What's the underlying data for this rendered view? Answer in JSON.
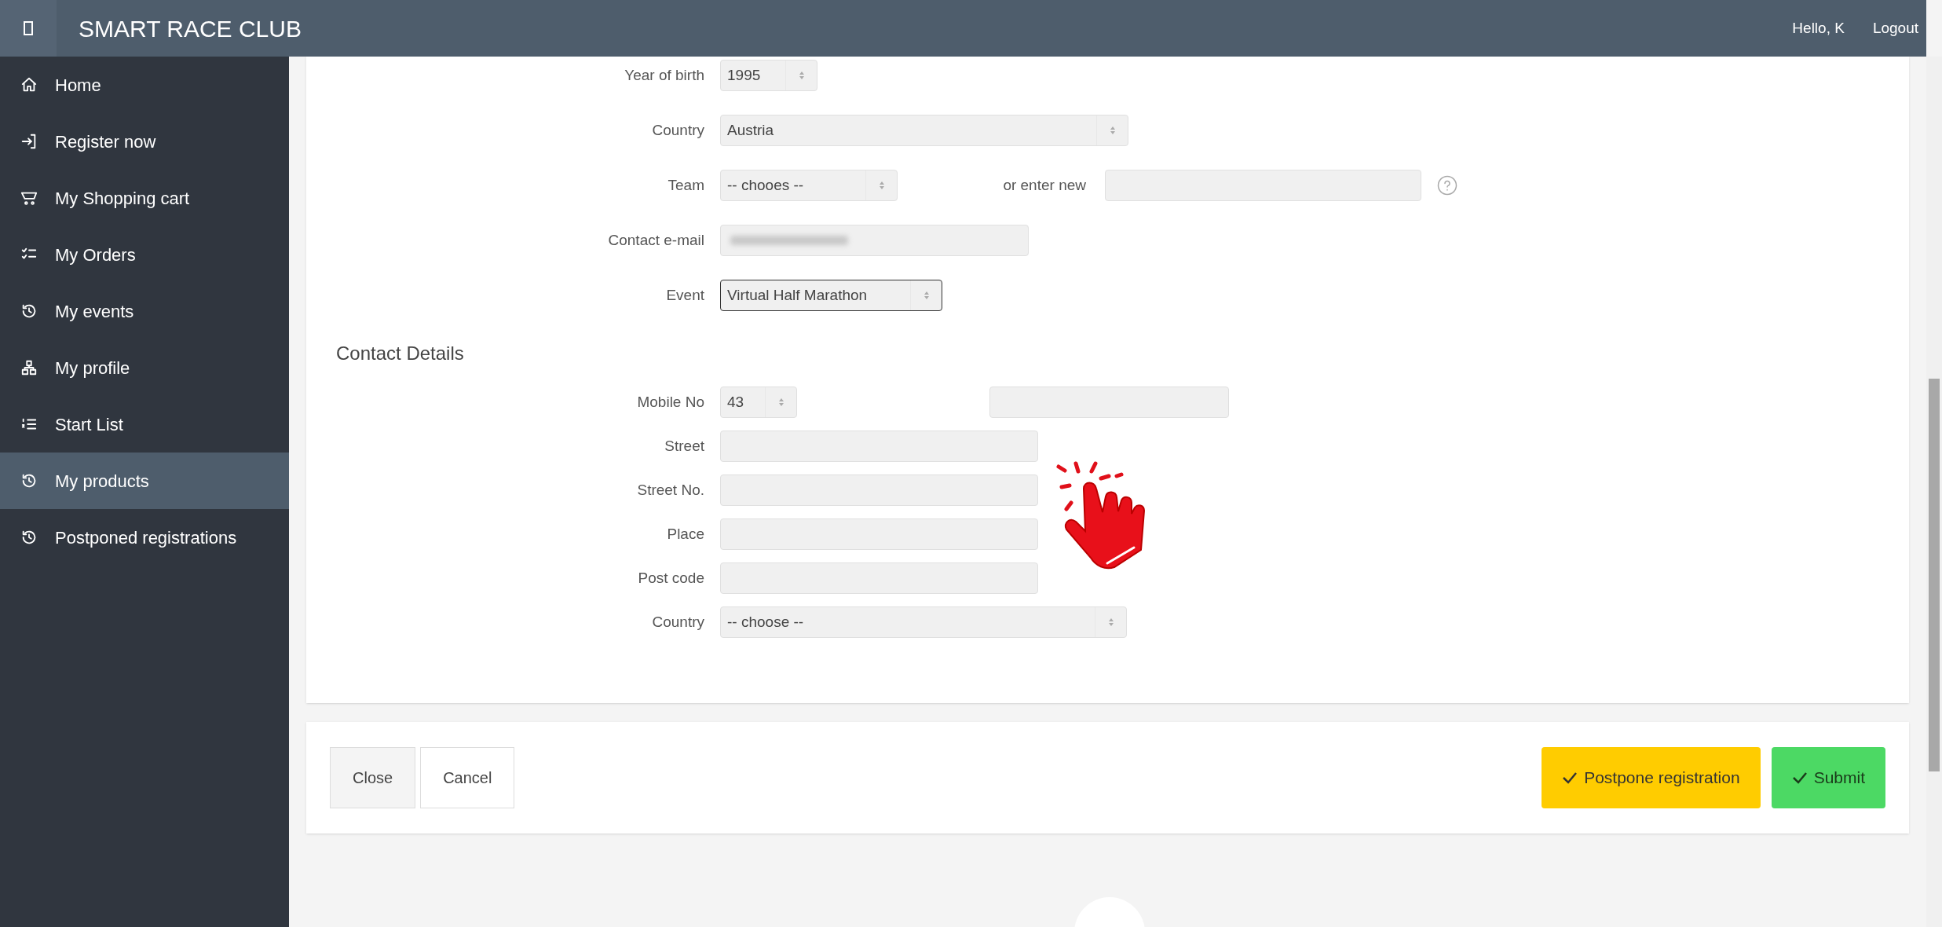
{
  "header": {
    "title": "SMART RACE CLUB",
    "greeting": "Hello, K",
    "logout": "Logout"
  },
  "sidebar": {
    "items": [
      {
        "label": "Home",
        "selected": false
      },
      {
        "label": "Register now",
        "selected": false
      },
      {
        "label": "My Shopping cart",
        "selected": false
      },
      {
        "label": "My Orders",
        "selected": false
      },
      {
        "label": "My events",
        "selected": false
      },
      {
        "label": "My profile",
        "selected": false
      },
      {
        "label": "Start List",
        "selected": false
      },
      {
        "label": "My products",
        "selected": true
      },
      {
        "label": "Postponed registrations",
        "selected": false
      }
    ]
  },
  "personal_rows": [
    {
      "label": "Year of birth",
      "kind": "select",
      "value": "1995",
      "focused": false
    },
    {
      "label": "Country",
      "kind": "select",
      "value": "Austria",
      "focused": false
    },
    {
      "label": "Team",
      "kind": "select",
      "value": "-- chooes --",
      "focused": false,
      "extra": {
        "label": "or enter new",
        "kind": "input"
      }
    },
    {
      "label": "Contact e-mail",
      "kind": "blurred",
      "focused": false
    },
    {
      "label": "Event",
      "kind": "select",
      "value": "Virtual Half Marathon",
      "focused": true
    }
  ],
  "contact_heading": "Contact Details",
  "contact_rows": [
    {
      "label": "Mobile No",
      "kind": "select",
      "value": "43",
      "focused": false,
      "extra": {
        "kind": "input"
      }
    },
    {
      "label": "Street",
      "kind": "input",
      "focused": false
    },
    {
      "label": "Street No.",
      "kind": "input",
      "focused": false
    },
    {
      "label": "Place",
      "kind": "input",
      "focused": false
    },
    {
      "label": "Post code",
      "kind": "input",
      "focused": false
    },
    {
      "label": "Country",
      "kind": "select",
      "value": "-- choose --",
      "focused": false
    }
  ],
  "footer": {
    "left_buttons": [
      "Close",
      "Cancel"
    ],
    "right_buttons": [
      {
        "label": "Postpone registration",
        "kind": "warning"
      },
      {
        "label": "Submit",
        "kind": "success"
      }
    ]
  }
}
